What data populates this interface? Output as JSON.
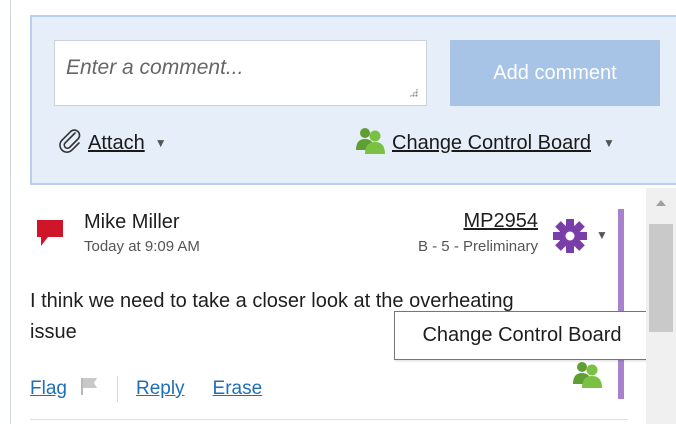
{
  "composer": {
    "placeholder": "Enter a comment...",
    "add_label": "Add comment",
    "attach_label": "Attach",
    "board_label": "Change Control Board"
  },
  "comment": {
    "author": "Mike Miller",
    "time": "Today at 9:09 AM",
    "doc_id": "MP2954",
    "doc_status": "B - 5 - Preliminary",
    "text": "I think we need to take a closer look at the overheating issue",
    "actions": {
      "flag": "Flag",
      "reply": "Reply",
      "erase": "Erase"
    }
  },
  "tooltip": "Change Control Board",
  "colors": {
    "flag_red": "#d0152b",
    "gear_purple": "#7a3ea8",
    "accent_purple": "#a882cd",
    "people_green": "#7ac143",
    "link_blue": "#1f6fb8",
    "button_blue": "#a7c3e6",
    "panel_bg": "#e5eef9"
  },
  "icons": {
    "attach": "paperclip-icon",
    "board": "people-icon",
    "comment_flag": "comment-flag-icon",
    "settings": "gear-icon",
    "flag": "flag-icon"
  }
}
